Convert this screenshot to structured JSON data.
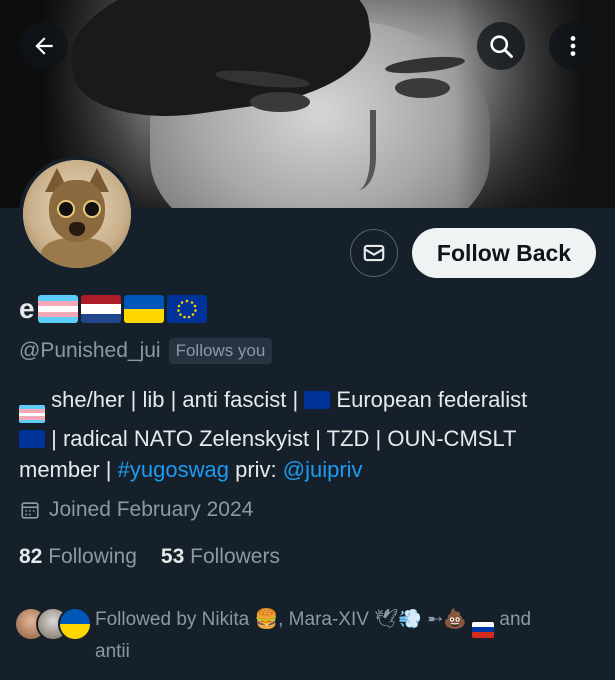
{
  "header": {
    "back_icon": "arrow-left-icon",
    "search_icon": "search-icon",
    "more_icon": "more-vertical-icon"
  },
  "profile": {
    "display_name_text": "e",
    "display_name_emoji": [
      "transgender-flag",
      "netherlands-flag",
      "ukraine-flag",
      "eu-flag"
    ],
    "handle": "@Punished_jui",
    "follows_you_badge": "Follows you",
    "bio": {
      "line1_text_a": "she/her | lib | anti fascist |",
      "line1_text_b": "European federalist",
      "line2_text": "| radical NATO Zelenskyist | TZD | OUN-CMSLT",
      "line3_text_a": "member |",
      "hashtag": "#yugoswag",
      "line3_text_b": "priv:",
      "mention": "@juipriv"
    },
    "joined": "Joined February 2024",
    "following_count": "82",
    "following_label": "Following",
    "followers_count": "53",
    "followers_label": "Followers"
  },
  "actions": {
    "message_icon": "mail-icon",
    "follow_label": "Follow Back"
  },
  "followed_by": {
    "prefix": "Followed by Nikita",
    "emoji1": "🍔",
    "second": ", Mara-XIV",
    "emoji2": "🕊💨",
    "mid": "➸💩",
    "suffix": "and",
    "last": "antii"
  },
  "colors": {
    "background": "#15202b",
    "primary_text": "#e7e9ea",
    "secondary_text": "#8b98a5",
    "link": "#1d9bf0",
    "button_bg": "#eff3f4"
  }
}
